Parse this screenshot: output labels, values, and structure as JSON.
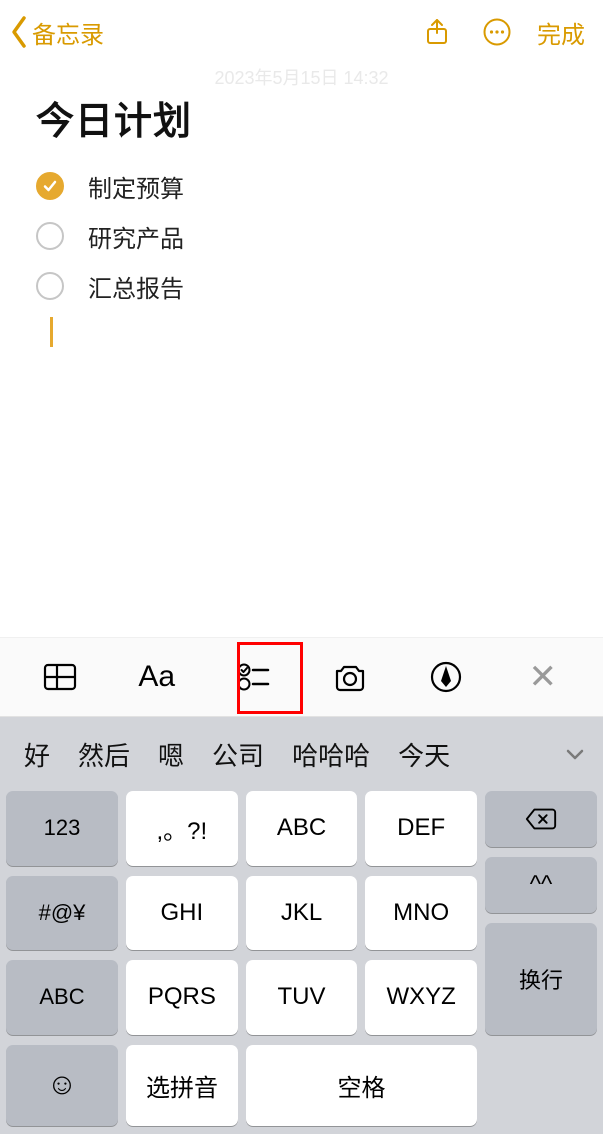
{
  "nav": {
    "back_label": "备忘录",
    "done_label": "完成"
  },
  "timestamp": "2023年5月15日 14:32",
  "note": {
    "title": "今日计划",
    "items": [
      {
        "text": "制定预算",
        "checked": true
      },
      {
        "text": "研究产品",
        "checked": false
      },
      {
        "text": "汇总报告",
        "checked": false
      }
    ]
  },
  "toolbar": {
    "aa_label": "Aa",
    "close_label": "✕"
  },
  "keyboard": {
    "candidates": [
      "好",
      "然后",
      "嗯",
      "公司",
      "哈哈哈",
      "今天"
    ],
    "left_col": [
      "123",
      "#@¥",
      "ABC"
    ],
    "main": [
      [
        ",。?!",
        "ABC",
        "DEF"
      ],
      [
        "GHI",
        "JKL",
        "MNO"
      ],
      [
        "PQRS",
        "TUV",
        "WXYZ"
      ]
    ],
    "bottom": {
      "select_pinyin": "选拼音",
      "space": "空格"
    },
    "right": {
      "face_label": "^^",
      "return_label": "换行"
    }
  }
}
